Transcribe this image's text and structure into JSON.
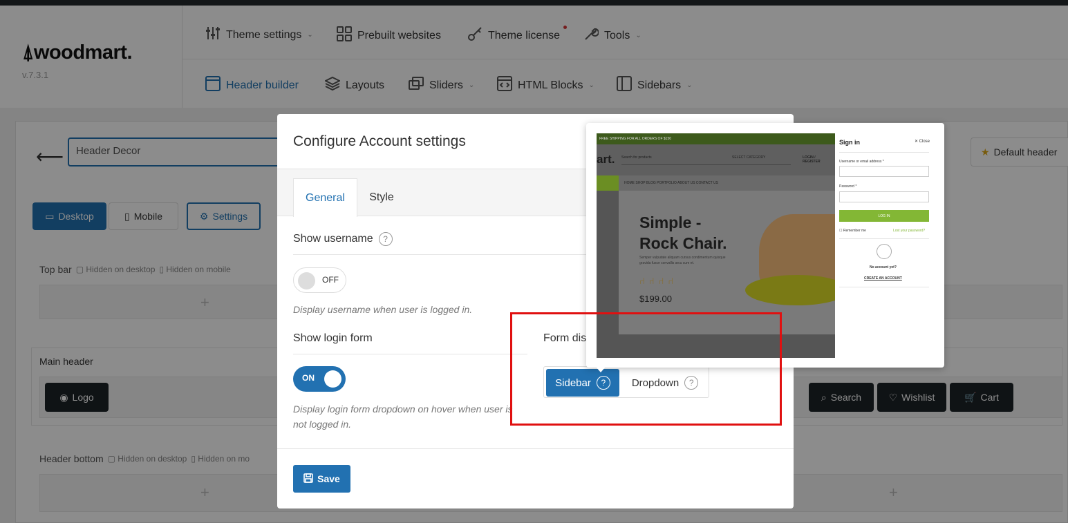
{
  "brand": {
    "logo": "woodmart.",
    "version": "v.7.3.1"
  },
  "nav": {
    "row1": [
      {
        "label": "Theme settings",
        "icon": "sliders-icon",
        "caret": true
      },
      {
        "label": "Prebuilt websites",
        "icon": "grid-icon",
        "caret": false
      },
      {
        "label": "Theme license",
        "icon": "key-icon",
        "caret": false
      },
      {
        "label": "Tools",
        "icon": "wrench-icon",
        "caret": true
      }
    ],
    "row2": [
      {
        "label": "Header builder",
        "icon": "window-icon",
        "active": true
      },
      {
        "label": "Layouts",
        "icon": "layers-icon"
      },
      {
        "label": "Sliders",
        "icon": "slides-icon",
        "caret": true
      },
      {
        "label": "HTML Blocks",
        "icon": "code-icon",
        "caret": true
      },
      {
        "label": "Sidebars",
        "icon": "sidebar-icon",
        "caret": true
      }
    ]
  },
  "builder": {
    "header_name": "Header Decor",
    "default_header": "Default header",
    "view_buttons": {
      "desktop": "Desktop",
      "mobile": "Mobile",
      "settings": "Settings"
    },
    "top_bar": "Top bar",
    "main_header": "Main header",
    "header_bottom": "Header bottom",
    "hidden_desktop": "Hidden on desktop",
    "hidden_mobile": "Hidden on mobile",
    "hidden_mobile_cut": "Hidden on mo",
    "elements": {
      "logo": "Logo",
      "search": "Search",
      "wishlist": "Wishlist",
      "cart": "Cart"
    }
  },
  "modal": {
    "title": "Configure Account settings",
    "tabs": [
      "General",
      "Style"
    ],
    "show_username": {
      "label": "Show username",
      "toggle": "OFF",
      "description": "Display username when user is logged in."
    },
    "show_login_form": {
      "label": "Show login form",
      "toggle": "ON",
      "description": "Display login form dropdown on hover when user is not logged in."
    },
    "form_display": {
      "label": "Form dis",
      "options": [
        "Sidebar",
        "Dropdown"
      ],
      "selected": "Sidebar"
    },
    "save": "Save"
  },
  "preview": {
    "topbar": "FREE SHIPPING FOR ALL ORDERS OF $150",
    "logo": "art.",
    "search_placeholder": "Search for products",
    "category": "SELECT CATEGORY",
    "login": "LOGIN / REGISTER",
    "menu": "HOME  SHOP  BLOG  PORTFOLIO  ABOUT US  CONTACT US",
    "hero_title_1": "Simple -",
    "hero_title_2": "Rock Chair.",
    "hero_text": "Semper vulputate aliquam cursus condimentum quisque gravida fusce convallis arcu cum et.",
    "price": "$199.00",
    "panel": {
      "title": "Sign in",
      "close": "Close",
      "username_label": "Username or email address *",
      "password_label": "Password *",
      "login_btn": "LOG IN",
      "remember": "Remember me",
      "lost": "Lost your password?",
      "no_account": "No account yet?",
      "create": "CREATE AN ACCOUNT"
    }
  },
  "colors": {
    "accent": "#2271b1",
    "highlight": "#e01010",
    "green": "#83b735"
  }
}
